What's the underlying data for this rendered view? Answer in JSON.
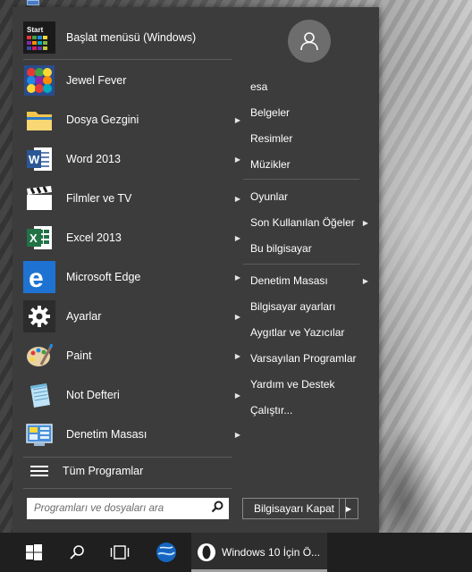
{
  "start_menu": {
    "programs": [
      {
        "label": "Başlat menüsü (Windows)",
        "icon": "start-menu-tiles-icon",
        "icon_text": "Start",
        "has_arrow": false
      },
      {
        "label": "Jewel Fever",
        "icon": "jewel-fever-icon",
        "has_arrow": false
      },
      {
        "label": "Dosya Gezgini",
        "icon": "folder-icon",
        "has_arrow": true
      },
      {
        "label": "Word 2013",
        "icon": "word-icon",
        "icon_text": "W",
        "has_arrow": true
      },
      {
        "label": "Filmler ve TV",
        "icon": "film-clapper-icon",
        "has_arrow": true
      },
      {
        "label": "Excel 2013",
        "icon": "excel-icon",
        "icon_text": "X",
        "has_arrow": true
      },
      {
        "label": "Microsoft Edge",
        "icon": "edge-icon",
        "icon_text": "e",
        "has_arrow": true
      },
      {
        "label": "Ayarlar",
        "icon": "gear-icon",
        "has_arrow": true
      },
      {
        "label": "Paint",
        "icon": "paint-palette-icon",
        "has_arrow": true
      },
      {
        "label": "Not Defteri",
        "icon": "notepad-icon",
        "has_arrow": true
      },
      {
        "label": "Denetim Masası",
        "icon": "control-panel-icon",
        "has_arrow": true
      }
    ],
    "all_programs_label": "Tüm Programlar",
    "search_placeholder": "Programları ve dosyaları ara",
    "right_items": [
      {
        "label": "esa",
        "has_arrow": false
      },
      {
        "label": "Belgeler",
        "has_arrow": false
      },
      {
        "label": "Resimler",
        "has_arrow": false
      },
      {
        "label": "Müzikler",
        "has_arrow": false
      },
      {
        "label": "Oyunlar",
        "has_arrow": false
      },
      {
        "label": "Son Kullanılan Öğeler",
        "has_arrow": true
      },
      {
        "label": "Bu bilgisayar",
        "has_arrow": false
      },
      {
        "label": "Denetim Masası",
        "has_arrow": true
      },
      {
        "label": "Bilgisayar ayarları",
        "has_arrow": false
      },
      {
        "label": "Aygıtlar ve Yazıcılar",
        "has_arrow": false
      },
      {
        "label": "Varsayılan Programlar",
        "has_arrow": false
      },
      {
        "label": "Yardım ve Destek",
        "has_arrow": false
      },
      {
        "label": "Çalıştır...",
        "has_arrow": false
      }
    ],
    "shutdown_label": "Bilgisayarı Kapat",
    "arrow_glyph": "▶"
  },
  "taskbar": {
    "start_icon": "windows-logo-icon",
    "search_icon": "search-icon",
    "task_view_icon": "task-view-icon",
    "pinned_app_icon": "globe-app-icon",
    "active_app_icon": "opera-icon",
    "active_app_label": "Windows 10 İçin Ö..."
  },
  "colors": {
    "menu_bg": "#3c3c3c",
    "taskbar_bg": "#1f1f1f",
    "edge_blue": "#1e73d2",
    "word_blue": "#2b5797",
    "excel_green": "#217346"
  }
}
